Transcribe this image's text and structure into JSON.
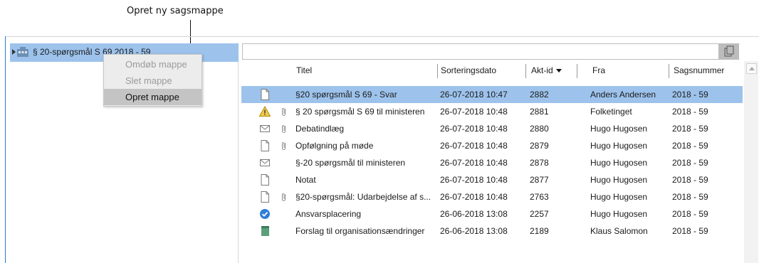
{
  "callout": {
    "text": "Opret ny sagsmappe"
  },
  "tree": {
    "root_label": "§ 20-spørgsmål S 69 2018 - 59"
  },
  "context_menu": {
    "items": [
      {
        "label": "Omdøb mappe",
        "enabled": false
      },
      {
        "label": "Slet mappe",
        "enabled": false
      },
      {
        "label": "Opret mappe",
        "enabled": true,
        "hovered": true
      }
    ]
  },
  "search": {
    "value": "",
    "button_icon": "copy-icon"
  },
  "table": {
    "columns": [
      {
        "key": "titel",
        "label": "Titel"
      },
      {
        "key": "sorteringsdato",
        "label": "Sorteringsdato"
      },
      {
        "key": "akt_id",
        "label": "Akt-id",
        "sorted": "desc"
      },
      {
        "key": "fra",
        "label": "Fra"
      },
      {
        "key": "sagsnummer",
        "label": "Sagsnummer"
      }
    ],
    "rows": [
      {
        "icon": "document-icon",
        "attachment": false,
        "titel": "§20 spørgsmål S 69 - Svar",
        "sorteringsdato": "26-07-2018 10:47",
        "akt_id": "2882",
        "fra": "Anders Andersen",
        "sagsnummer": "2018 - 59",
        "selected": true
      },
      {
        "icon": "warning-icon",
        "attachment": true,
        "titel": "§ 20 spørgsmål S 69 til ministeren",
        "sorteringsdato": "26-07-2018 10:48",
        "akt_id": "2881",
        "fra": "Folketinget",
        "sagsnummer": "2018 - 59"
      },
      {
        "icon": "envelope-icon",
        "attachment": true,
        "titel": "Debatindlæg",
        "sorteringsdato": "26-07-2018 10:48",
        "akt_id": "2880",
        "fra": "Hugo Hugosen",
        "sagsnummer": "2018 - 59"
      },
      {
        "icon": "document-icon",
        "attachment": true,
        "titel": "Opfølgning på møde",
        "sorteringsdato": "26-07-2018 10:48",
        "akt_id": "2879",
        "fra": "Hugo Hugosen",
        "sagsnummer": "2018 - 59"
      },
      {
        "icon": "envelope-icon",
        "attachment": false,
        "titel": "§-20 spørgsmål til ministeren",
        "sorteringsdato": "26-07-2018 10:48",
        "akt_id": "2878",
        "fra": "Hugo Hugosen",
        "sagsnummer": "2018 - 59"
      },
      {
        "icon": "document-icon",
        "attachment": false,
        "titel": "Notat",
        "sorteringsdato": "26-07-2018 10:48",
        "akt_id": "2877",
        "fra": "Hugo Hugosen",
        "sagsnummer": "2018 - 59"
      },
      {
        "icon": "document-icon",
        "attachment": true,
        "titel": "§20-spørgsmål: Udarbejdelse af s...",
        "sorteringsdato": "26-07-2018 10:48",
        "akt_id": "2763",
        "fra": "Hugo Hugosen",
        "sagsnummer": "2018 - 59"
      },
      {
        "icon": "check-circle-icon",
        "attachment": false,
        "titel": "Ansvarsplacering",
        "sorteringsdato": "26-06-2018 13:08",
        "akt_id": "2257",
        "fra": "Hugo Hugosen",
        "sagsnummer": "2018 - 59"
      },
      {
        "icon": "binder-icon",
        "attachment": false,
        "titel": "Forslag til organisationsændringer",
        "sorteringsdato": "26-06-2018 13:08",
        "akt_id": "2189",
        "fra": "Klaus Salomon",
        "sagsnummer": "2018 - 59"
      }
    ]
  },
  "colors": {
    "selection": "#9dc3ec",
    "accent": "#2a7ad0",
    "menu_bg": "#ececec",
    "menu_hover": "#c4c4c4"
  }
}
